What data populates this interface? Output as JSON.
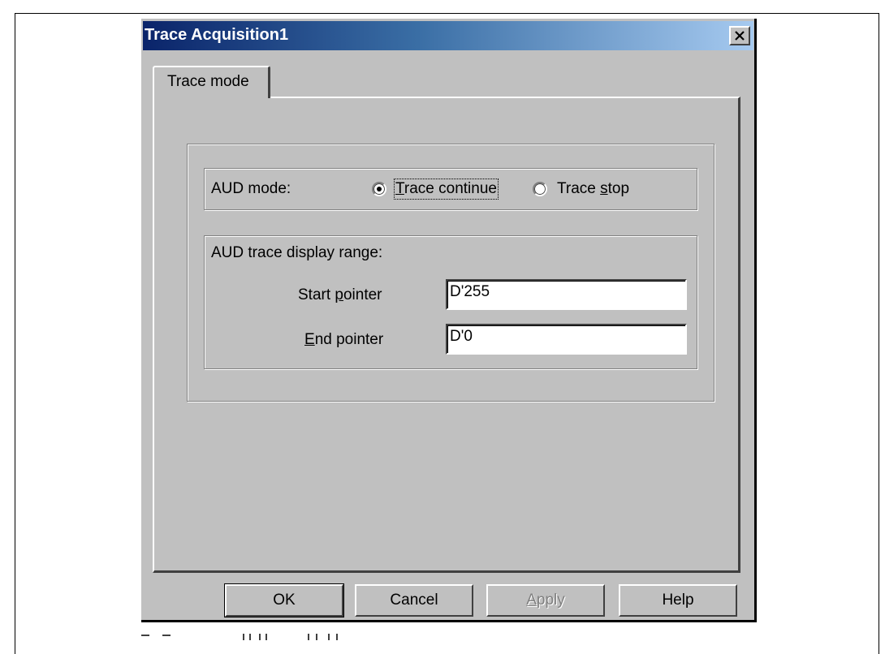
{
  "window": {
    "title": "Trace Acquisition1",
    "close_icon": "close-icon"
  },
  "tabs": [
    {
      "label": "Trace mode",
      "selected": true
    }
  ],
  "aud_mode": {
    "label": "AUD mode:",
    "options": [
      {
        "label": "Trace continue",
        "selected": true
      },
      {
        "label": "Trace stop",
        "selected": false
      }
    ]
  },
  "display_range": {
    "label": "AUD trace display range:",
    "start_pointer": {
      "label": "Start pointer",
      "value": "D'255"
    },
    "end_pointer": {
      "label": "End pointer",
      "value": "D'0"
    }
  },
  "buttons": {
    "ok": "OK",
    "cancel": "Cancel",
    "apply": "Apply",
    "help": "Help"
  }
}
